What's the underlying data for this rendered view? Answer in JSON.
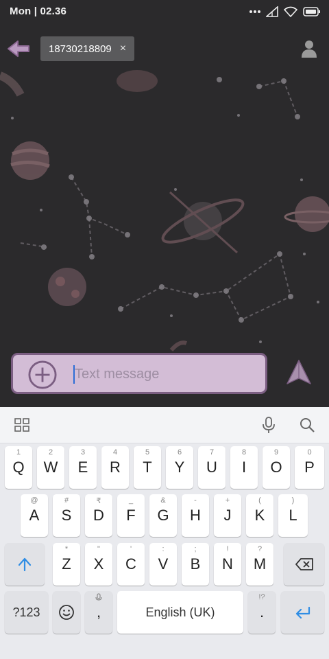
{
  "status": {
    "time": "Mon | 02.36",
    "icons": [
      "dots-icon",
      "signal-icon",
      "wifi-icon",
      "battery-icon"
    ]
  },
  "header": {
    "back_icon": "back-arrow-icon",
    "recipient": "18730218809",
    "remove_glyph": "×",
    "contact_icon": "person-icon"
  },
  "compose": {
    "attach_icon": "plus-circle-icon",
    "placeholder": "Text message",
    "value": "",
    "send_icon": "send-icon"
  },
  "keyboard": {
    "toolbar": [
      "grid-icon",
      "microphone-icon",
      "search-icon"
    ],
    "row1": [
      {
        "k": "Q",
        "h": "1"
      },
      {
        "k": "W",
        "h": "2"
      },
      {
        "k": "E",
        "h": "3"
      },
      {
        "k": "R",
        "h": "4"
      },
      {
        "k": "T",
        "h": "5"
      },
      {
        "k": "Y",
        "h": "6"
      },
      {
        "k": "U",
        "h": "7"
      },
      {
        "k": "I",
        "h": "8"
      },
      {
        "k": "O",
        "h": "9"
      },
      {
        "k": "P",
        "h": "0"
      }
    ],
    "row2": [
      {
        "k": "A",
        "h": "@"
      },
      {
        "k": "S",
        "h": "#"
      },
      {
        "k": "D",
        "h": "₹"
      },
      {
        "k": "F",
        "h": "_"
      },
      {
        "k": "G",
        "h": "&"
      },
      {
        "k": "H",
        "h": "-"
      },
      {
        "k": "J",
        "h": "+"
      },
      {
        "k": "K",
        "h": "("
      },
      {
        "k": "L",
        "h": ")"
      }
    ],
    "row3": [
      {
        "k": "Z",
        "h": "*"
      },
      {
        "k": "X",
        "h": "\""
      },
      {
        "k": "C",
        "h": "'"
      },
      {
        "k": "V",
        "h": ":"
      },
      {
        "k": "B",
        "h": ";"
      },
      {
        "k": "N",
        "h": "!"
      },
      {
        "k": "M",
        "h": "?"
      }
    ],
    "symbols_label": "?123",
    "comma": ",",
    "space_label": "English (UK)",
    "period": ".",
    "period_hint": "!?",
    "accent_color": "#2f8de4"
  },
  "colors": {
    "compose_bg": "#d3bdd6",
    "compose_border": "#7b5e82",
    "icon_purple": "#8f6b96"
  }
}
